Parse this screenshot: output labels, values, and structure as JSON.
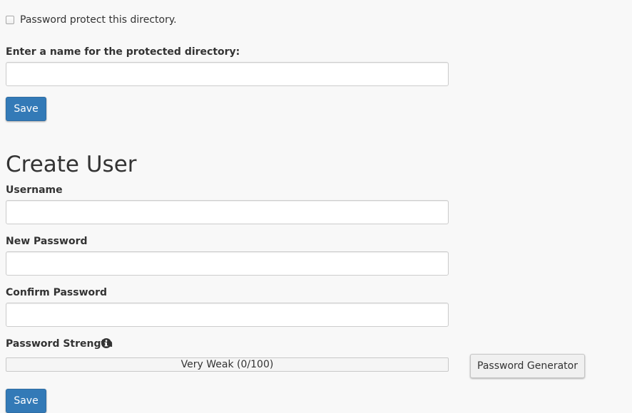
{
  "protect": {
    "checkbox_checked": false,
    "checkbox_label": "Password protect this directory.",
    "name_label": "Enter a name for the protected directory:",
    "name_value": "",
    "save_label": "Save"
  },
  "create_user": {
    "heading": "Create User",
    "username_label": "Username",
    "username_value": "",
    "new_password_label": "New Password",
    "new_password_value": "",
    "confirm_password_label": "Confirm Password",
    "confirm_password_value": "",
    "strength_label": "Password Strength",
    "strength_icon": "info-circle-icon",
    "strength_text": "Very Weak (0/100)",
    "strength_value": 0,
    "strength_max": 100,
    "generator_label": "Password Generator",
    "save_label": "Save"
  },
  "colors": {
    "primary": "#337ab7",
    "background": "#f8f8f8",
    "text": "#333333"
  }
}
